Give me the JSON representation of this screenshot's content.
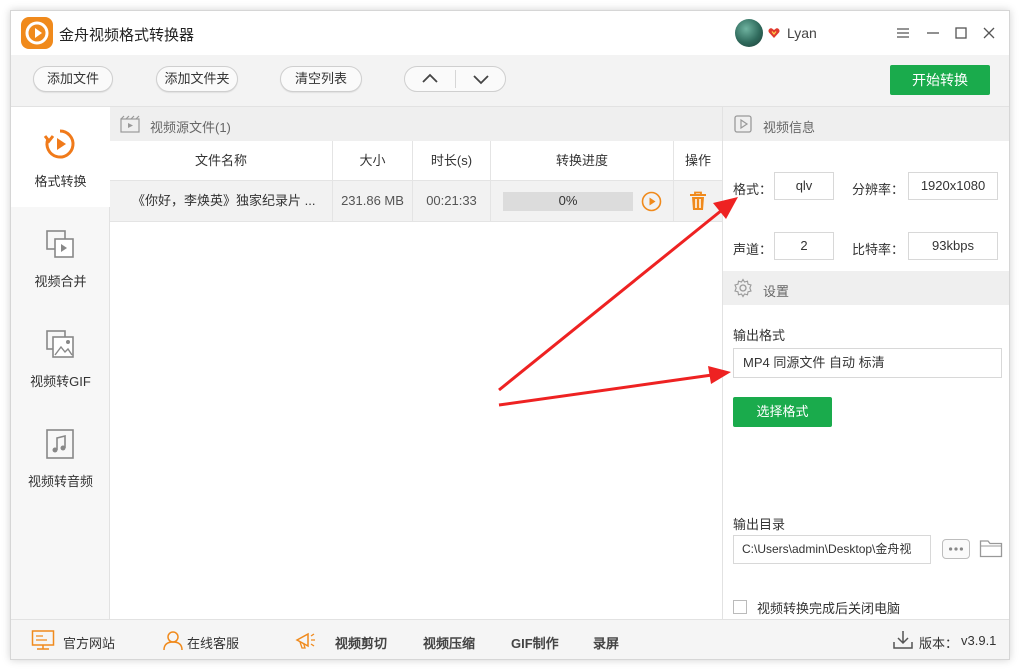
{
  "app": {
    "title": "金舟视频格式转换器",
    "user_name": "Lyan"
  },
  "toolbar": {
    "add_file": "添加文件",
    "add_folder": "添加文件夹",
    "clear_list": "清空列表",
    "start": "开始转换"
  },
  "sidebar": {
    "items": [
      {
        "label": "格式转换",
        "icon": "convert-icon"
      },
      {
        "label": "视频合并",
        "icon": "merge-icon"
      },
      {
        "label": "视频转GIF",
        "icon": "gif-icon"
      },
      {
        "label": "视频转音频",
        "icon": "audio-icon"
      }
    ]
  },
  "file_list": {
    "header": "视频源文件(1)",
    "columns": [
      "文件名称",
      "大小",
      "时长(s)",
      "转换进度",
      "操作"
    ],
    "rows": [
      {
        "name": "《你好，李焕英》独家纪录片 ...",
        "size": "231.86 MB",
        "duration": "00:21:33",
        "progress_text": "0%",
        "progress": 0
      }
    ]
  },
  "video_info": {
    "header": "视频信息",
    "format_label": "格式：",
    "format": "qlv",
    "resolution_label": "分辨率：",
    "resolution": "1920x1080",
    "channels_label": "声道：",
    "channels": "2",
    "bitrate_label": "比特率：",
    "bitrate": "93kbps"
  },
  "settings": {
    "header": "设置",
    "output_format_label": "输出格式",
    "output_format": "MP4 同源文件 自动 标清",
    "select_format": "选择格式",
    "output_dir_label": "输出目录",
    "output_dir": "C:\\Users\\admin\\Desktop\\金舟视",
    "shutdown_label": "视频转换完成后关闭电脑"
  },
  "footer": {
    "website": "官方网站",
    "service": "在线客服",
    "cut": "视频剪切",
    "compress": "视频压缩",
    "gif": "GIF制作",
    "record": "录屏",
    "version_label": "版本：",
    "version": "v3.9.1"
  },
  "colors": {
    "accent": "#1aab4c",
    "brand": "#f08a1c",
    "arrow": "#ee2222"
  }
}
